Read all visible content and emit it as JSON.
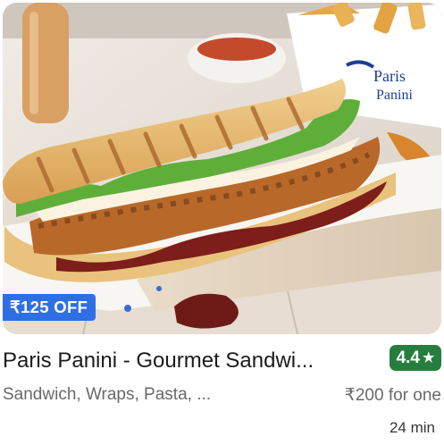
{
  "restaurant": {
    "name": "Paris Panini - Gourmet Sandwi...",
    "rating": "4.4",
    "cuisines": "Sandwich, Wraps, Pasta, ...",
    "price_for_one": "₹200 for one",
    "delivery_time": "24 min",
    "offer": "₹125 OFF",
    "photo_box_text": [
      "Paris",
      "Panini"
    ]
  },
  "colors": {
    "offer_badge": "#2f6fe4",
    "rating_badge": "#267e3e",
    "primary_text": "#1c1c1c",
    "secondary_text": "#696969"
  },
  "icons": {
    "rating": "star-icon"
  }
}
